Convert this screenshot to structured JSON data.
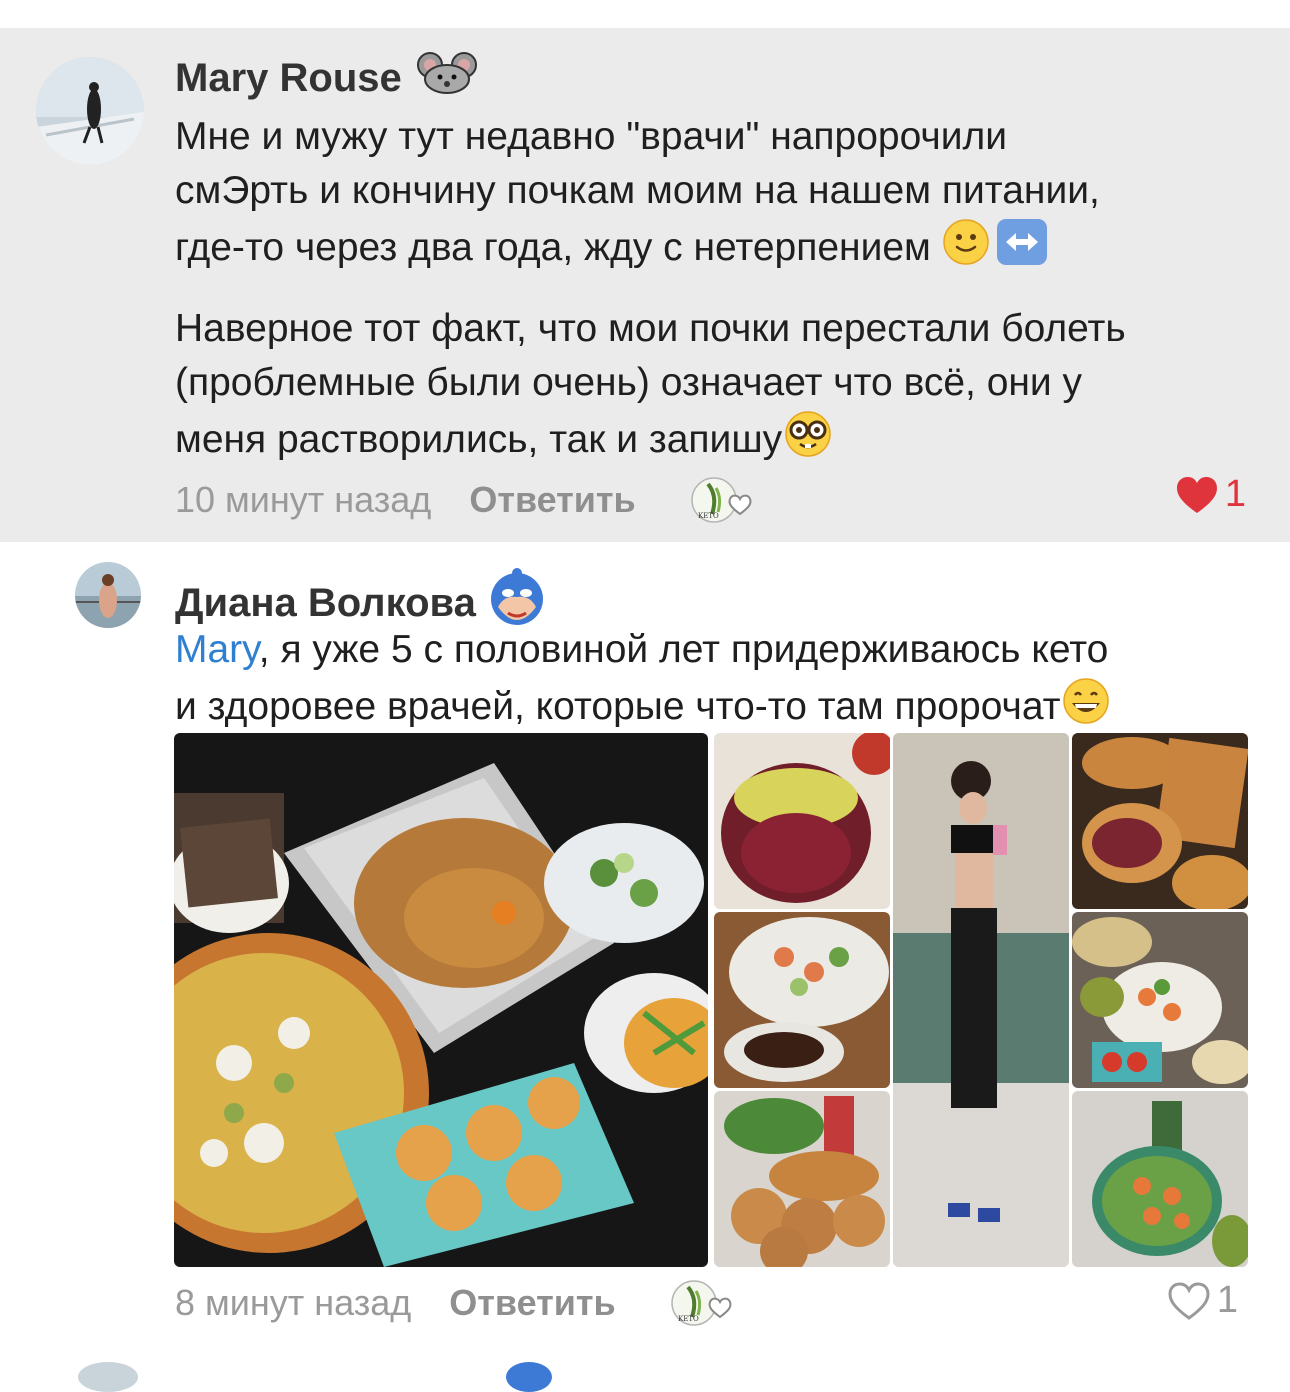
{
  "comments": [
    {
      "author": "Mary Rouse",
      "badge_icon": "mouse-icon",
      "paragraphs": [
        "Мне и мужу тут недавно \"врачи\" напророчили\nсмЭрть и кончину почкам моим на нашем питании,\nгде-то через два года, жду с нетерпением",
        "Наверное тот факт, что мои почки перестали болеть\n(проблемные были очень) означает что всё, они у\nменя растворились, так и запишу"
      ],
      "time": "10 минут назад",
      "reply_label": "Ответить",
      "likes": "1",
      "liked": true,
      "background": "#ebebeb"
    },
    {
      "author": "Диана Волкова",
      "badge_icon": "superhero-mask-icon",
      "mention": "Mary",
      "text_line1_rest": ", я уже 5 с половиной лет придерживаюсь кето",
      "text_line2": "и здоровее врачей, которые что-то там пророчат",
      "time": "8 минут назад",
      "reply_label": "Ответить",
      "likes": "1",
      "liked": false
    }
  ],
  "reaction_badge": {
    "label": "KETO",
    "icon": "keto-heart-icon"
  },
  "photos": [
    {
      "name": "photo-feast",
      "desc_icon": "food-collage"
    },
    {
      "name": "photo-dessert"
    },
    {
      "name": "photo-fitness-selfie"
    },
    {
      "name": "photo-pastry"
    },
    {
      "name": "photo-salad"
    },
    {
      "name": "photo-meal-spread"
    },
    {
      "name": "photo-cookies"
    },
    {
      "name": "photo-shrimp-salad"
    }
  ],
  "colors": {
    "like_red": "#e0343d",
    "mention_blue": "#2f80d1",
    "muted": "#9a9a9a"
  }
}
